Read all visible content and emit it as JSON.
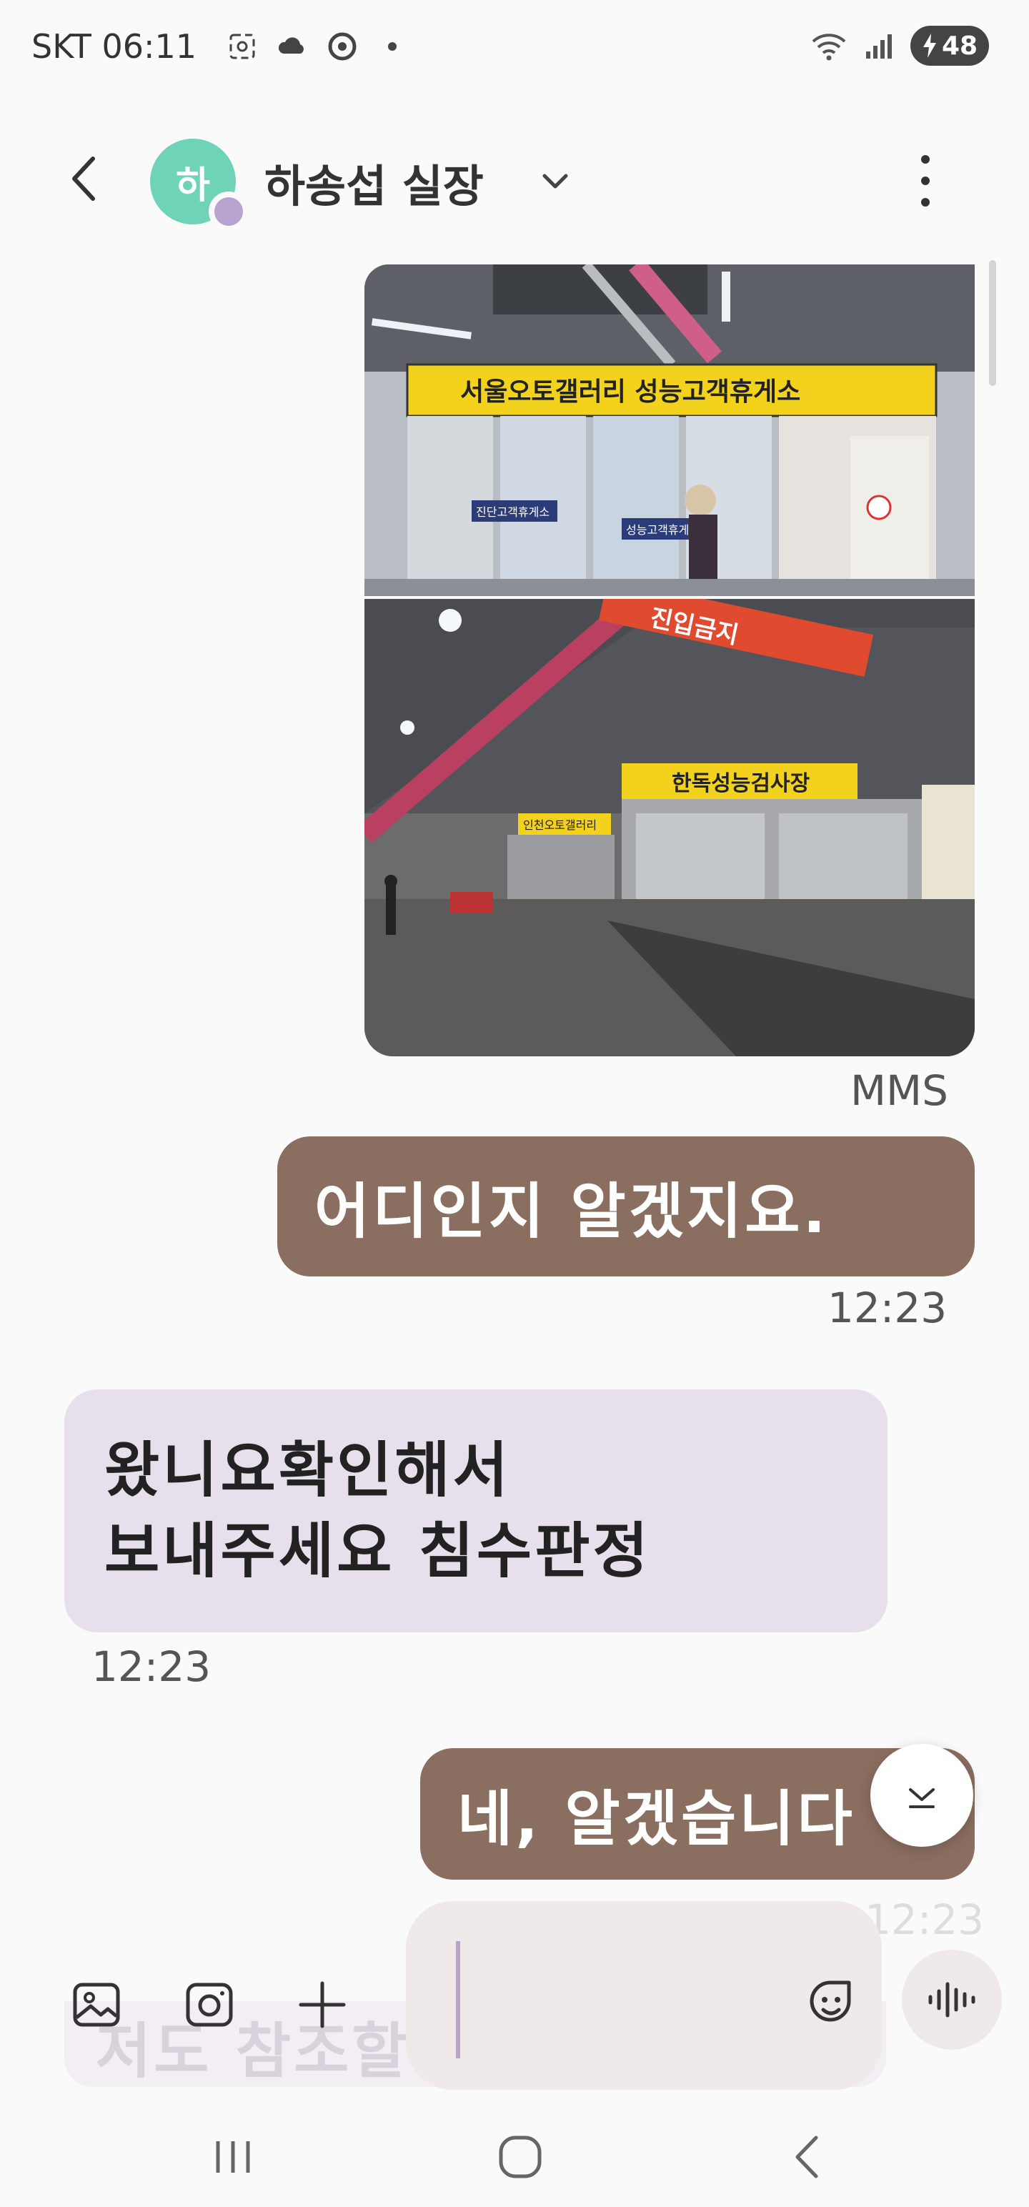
{
  "status_bar": {
    "carrier_time": "SKT 06:11",
    "battery_level": "48",
    "icons": [
      "screenshot-icon",
      "cloud-icon",
      "chrome-icon",
      "dot-icon",
      "wifi-icon",
      "signal-icon",
      "battery-charging-icon"
    ]
  },
  "header": {
    "avatar_initial": "하",
    "contact_name": "하송섭 실장",
    "icons": [
      "back-arrow-icon",
      "chevron-down-icon",
      "more-vertical-icon"
    ]
  },
  "messages": {
    "mms_label": "MMS",
    "m1_text": "어디인지 알겠지요.",
    "m1_time": "12:23",
    "m2_line1": "왔니요확인해서",
    "m2_line2": "보내주세요 침수판정",
    "m2_time": "12:23",
    "m3_text": "네, 알겠습니다",
    "m3_time": "12:23",
    "partial_text": "저도 참조할께"
  },
  "images": {
    "img1_sign": "서울오토갤러리 성능고객휴게소",
    "img1_sub_a": "진단고객휴게소",
    "img1_sub_b": "성능고객휴게소",
    "img2_sign_main": "한독성능검사장",
    "img2_sign_entry": "진입금지",
    "img2_sign_small": "인천오토갤러리"
  },
  "input_bar": {
    "icons": [
      "gallery-icon",
      "camera-icon",
      "plus-icon",
      "sticker-icon",
      "voice-wave-icon"
    ]
  },
  "nav_bar": {
    "icons": [
      "recents-icon",
      "home-icon",
      "back-nav-icon"
    ]
  },
  "colors": {
    "outgoing_bubble": "#8a6e60",
    "incoming_bubble": "#e7dfeb",
    "avatar": "#6fd3b7",
    "background": "#fbfafa"
  }
}
